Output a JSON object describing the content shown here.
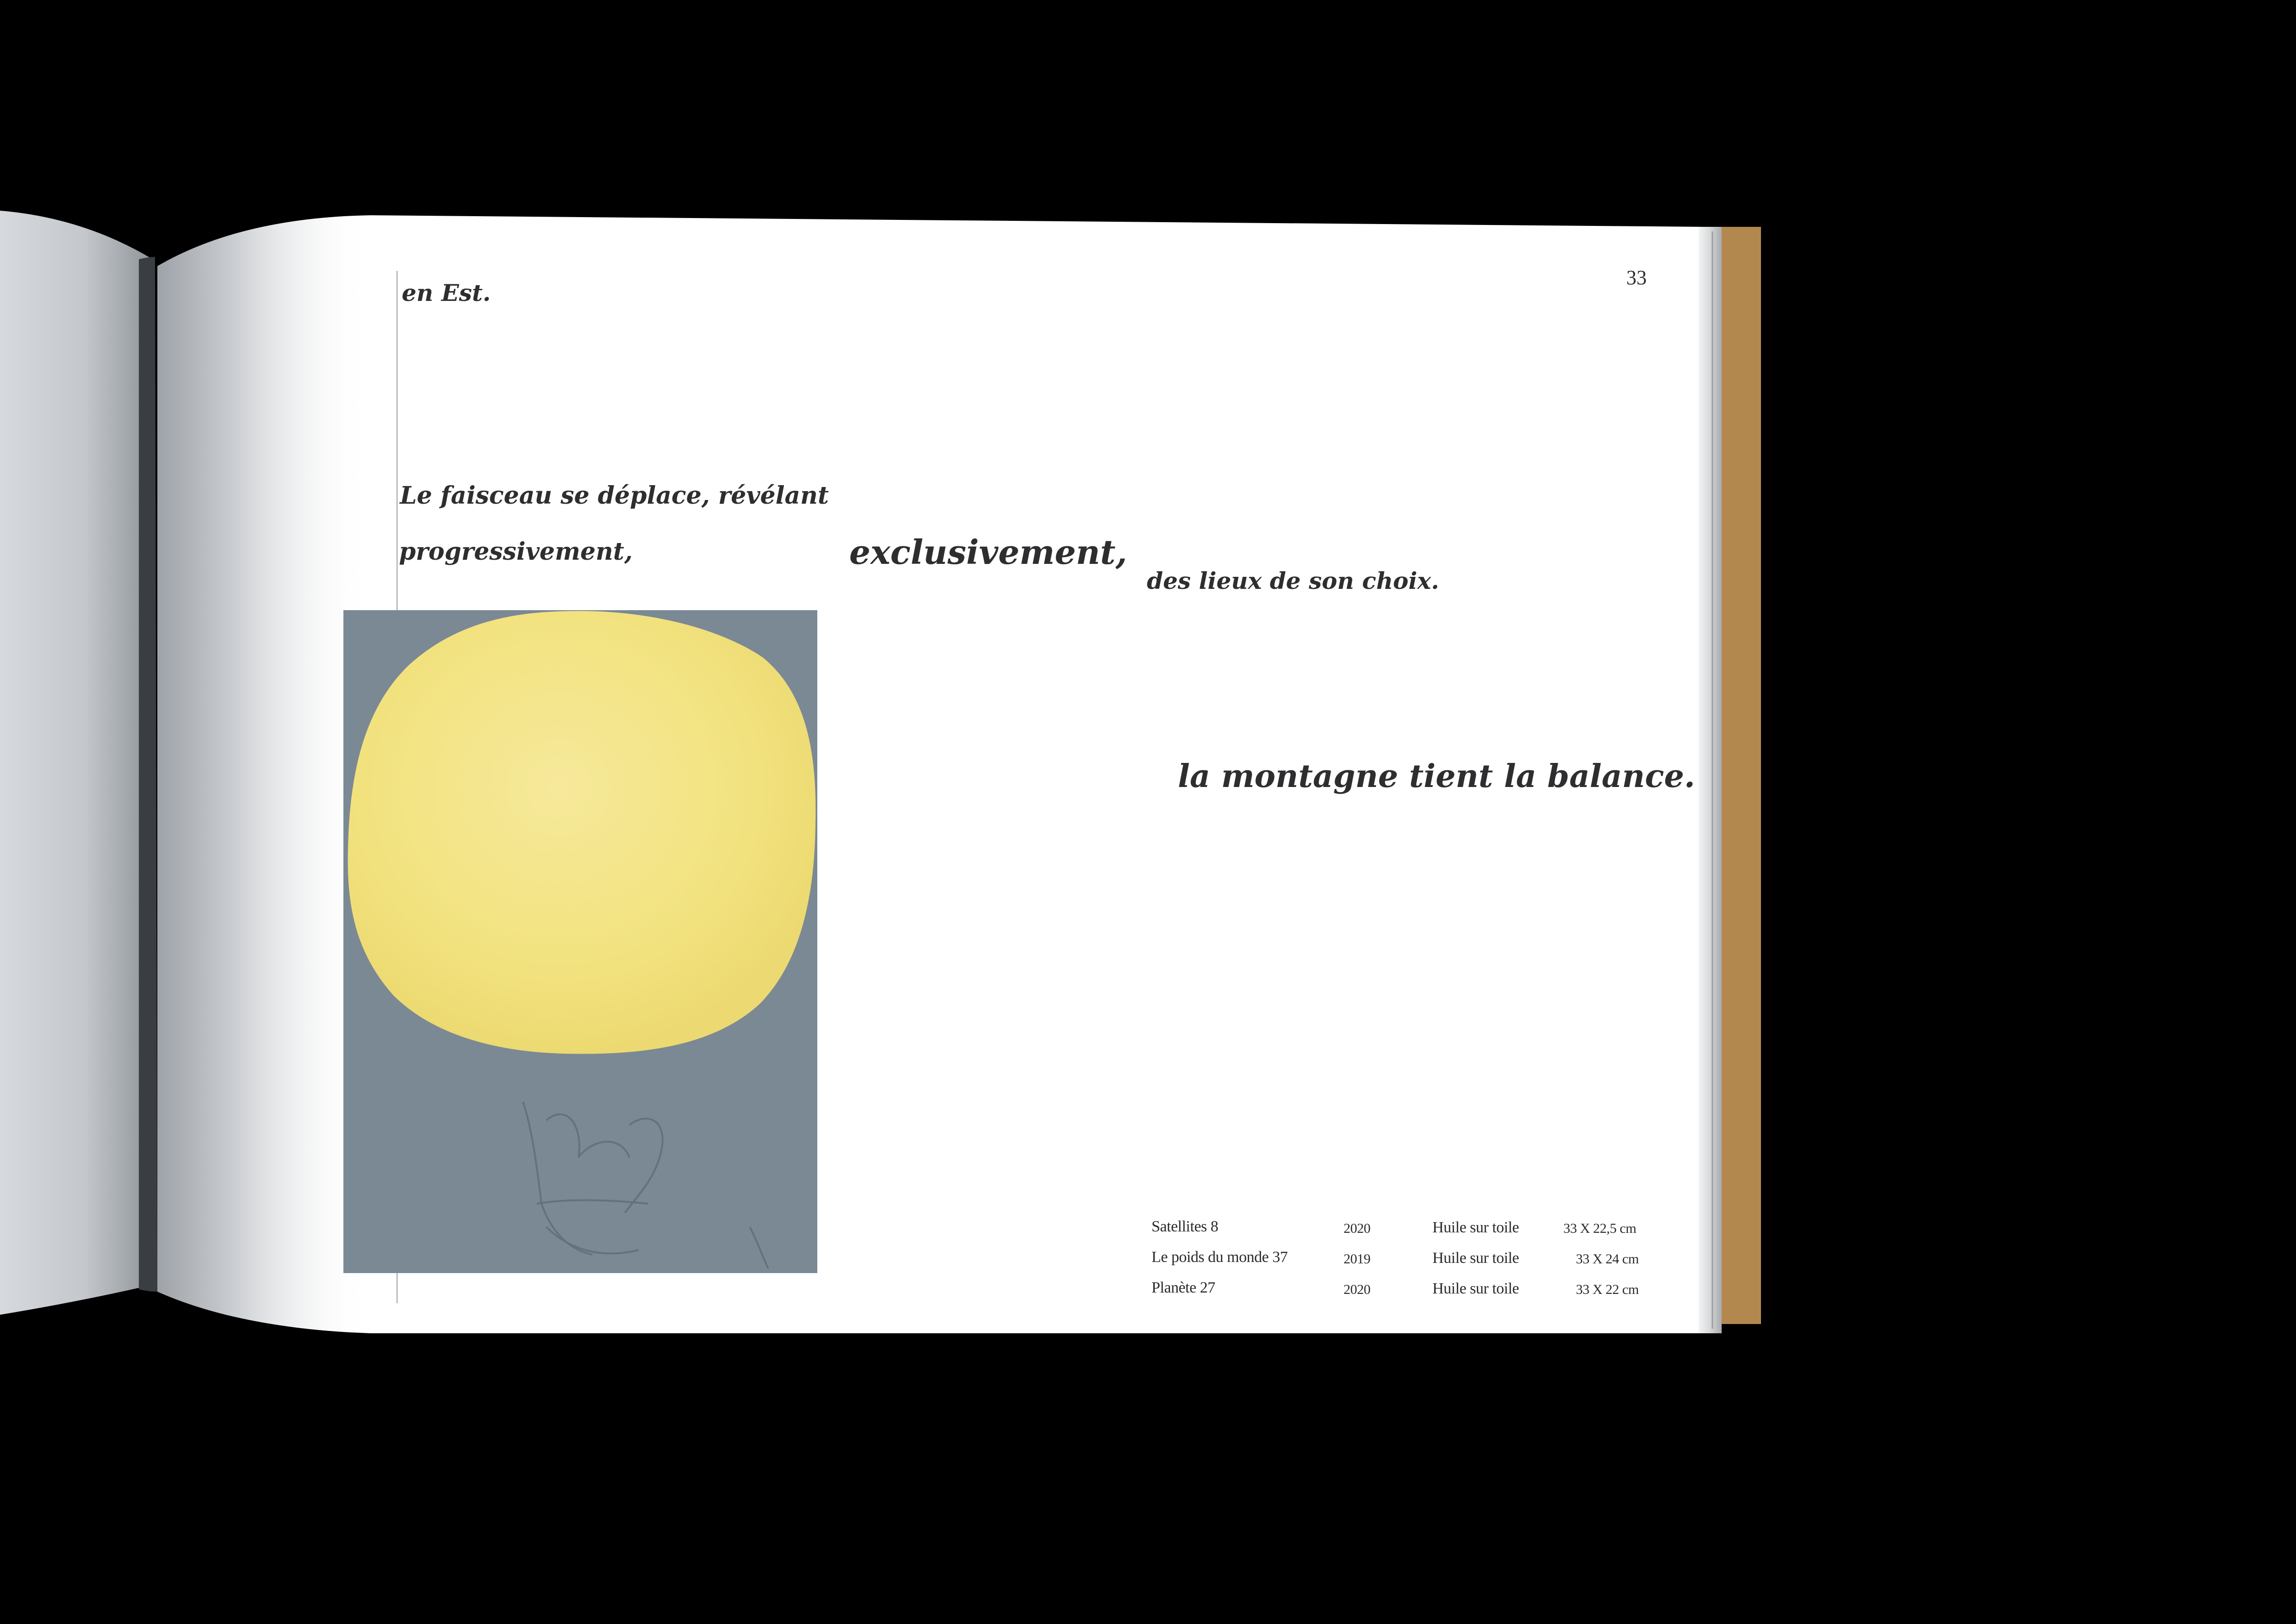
{
  "page": {
    "number": "33"
  },
  "text": {
    "en_est": "en Est.",
    "le_faisceau": "Le faisceau se déplace, révélant",
    "progressivement": "progressivement,",
    "exclusivement": "exclusivement,",
    "des_lieux": "des lieux de son choix.",
    "la_montagne": "la montagne tient la balance."
  },
  "captions": [
    {
      "title": "Satellites 8",
      "year": "2020",
      "medium": "Huile sur toile",
      "size": "33 X 22,5 cm"
    },
    {
      "title": "Le poids du monde 37",
      "year": "2019",
      "medium": "Huile sur toile",
      "size": "33 X 24 cm"
    },
    {
      "title": "Planète 27",
      "year": "2020",
      "medium": "Huile sur toile",
      "size": "33 X 22 cm"
    }
  ],
  "colors": {
    "background": "#000000",
    "page": "#ffffff",
    "left_page_shadow": "#b9bdc2",
    "cover_edge": "#b3884e",
    "painting_background": "#7b8995",
    "painting_sphere": "#f3e583",
    "text": "#2e2e30"
  }
}
